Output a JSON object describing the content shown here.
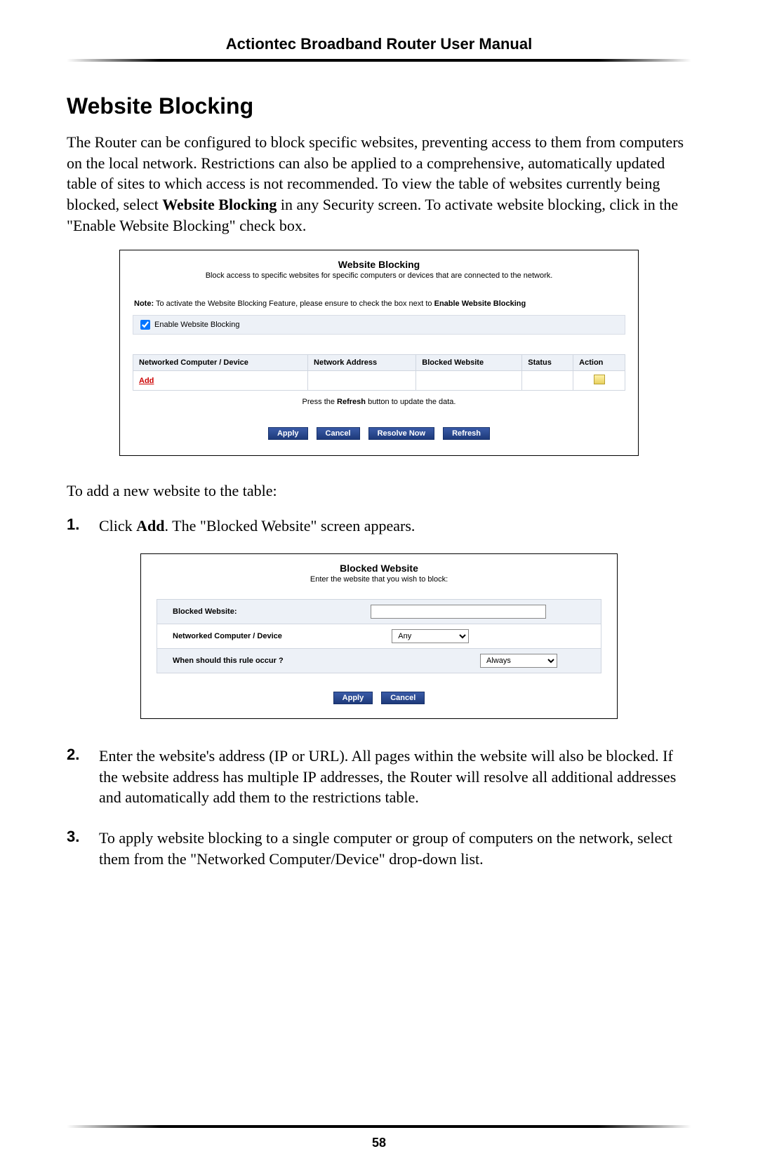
{
  "header": {
    "title": "Actiontec Broadband Router User Manual"
  },
  "section": {
    "heading": "Website Blocking"
  },
  "intro": {
    "pre": "The Router can be configured to block specific websites, preventing access to them from computers on the local network. Restrictions can also be applied to a comprehensive, automatically updated table of sites to which access is not recommended. To view the table of websites currently being blocked, select ",
    "bold1": "Website Blocking",
    "post": " in any Security screen. To activate website blocking, click in the \"Enable Website Blocking\" check box."
  },
  "fig1": {
    "title": "Website Blocking",
    "subtitle": "Block access to specific websites for specific computers or devices that are connected to the network.",
    "note_prefix": "Note:",
    "note_mid": " To activate the Website Blocking Feature, please ensure to check the box next to ",
    "note_bold": "Enable Website Blocking",
    "enable_label": "Enable Website Blocking",
    "cols": [
      "Networked Computer / Device",
      "Network Address",
      "Blocked Website",
      "Status",
      "Action"
    ],
    "add": "Add",
    "refresh_pre": "Press the ",
    "refresh_bold": "Refresh",
    "refresh_post": " button to update the data.",
    "buttons": {
      "apply": "Apply",
      "cancel": "Cancel",
      "resolve": "Resolve Now",
      "refresh": "Refresh"
    }
  },
  "lead2": "To add a new website to the table:",
  "step1": {
    "num": "1.",
    "pre": "Click ",
    "bold": "Add",
    "post": ". The \"Blocked Website\" screen appears."
  },
  "fig2": {
    "title": "Blocked Website",
    "subtitle": "Enter the website that you wish to block:",
    "row1": "Blocked Website:",
    "row2": "Networked Computer / Device",
    "row2_val": "Any",
    "row3": "When should this rule occur ?",
    "row3_val": "Always",
    "buttons": {
      "apply": "Apply",
      "cancel": "Cancel"
    }
  },
  "step2": {
    "num": "2.",
    "text_a": "Enter the website's address (",
    "text_ip": "IP",
    "text_b": " or ",
    "text_url": "URL",
    "text_c": "). All pages within the website will also be blocked. If the website address has multiple ",
    "text_ip2": "IP",
    "text_d": " addresses, the Router will resolve all additional addresses and automatically add them to the restrictions table."
  },
  "step3": {
    "num": "3.",
    "text": "To apply website blocking to a single computer or group of computers on the network, select them from the \"Networked Computer/Device\" drop-down list."
  },
  "footer": {
    "page": "58"
  }
}
